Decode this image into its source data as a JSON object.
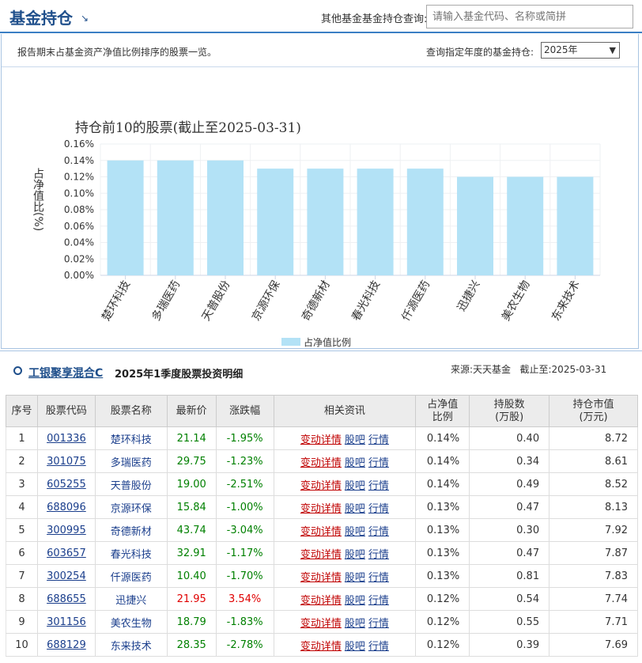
{
  "header": {
    "title": "基金持仓",
    "query_label": "其他基金基金持仓查询:",
    "query_placeholder": "请输入基金代码、名称或简拼"
  },
  "desc": {
    "text": "报告期末占基金资产净值比例排序的股票一览。",
    "year_label": "查询指定年度的基金持仓:",
    "year_value": "2025年"
  },
  "chart_data": {
    "type": "bar",
    "title": "持仓前10的股票(截止至2025-03-31)",
    "ylabel": "占净值比(%)",
    "categories": [
      "楚环科技",
      "多瑞医药",
      "天普股份",
      "京源环保",
      "奇德新材",
      "春光科技",
      "仟源医药",
      "迅捷兴",
      "美农生物",
      "东来技术"
    ],
    "series": [
      {
        "name": "占净值比例",
        "values": [
          0.14,
          0.14,
          0.14,
          0.13,
          0.13,
          0.13,
          0.13,
          0.12,
          0.12,
          0.12
        ]
      }
    ],
    "yticks": [
      "0.16%",
      "0.14%",
      "0.12%",
      "0.10%",
      "0.08%",
      "0.06%",
      "0.04%",
      "0.02%",
      "0.00%"
    ],
    "ylim": [
      0,
      0.16
    ],
    "legend_position": "bottom",
    "bar_color": "#b3e2f6"
  },
  "fund": {
    "name": "工银聚享混合C",
    "period_title": "2025年1季度股票投资明细",
    "source": "来源:天天基金",
    "as_of": "截止至:2025-03-31"
  },
  "table": {
    "headers": [
      "序号",
      "股票代码",
      "股票名称",
      "最新价",
      "涨跌幅",
      "相关资讯",
      "占净值\n比例",
      "持股数\n(万股)",
      "持仓市值\n(万元)"
    ],
    "link_labels": [
      "变动详情",
      "股吧",
      "行情"
    ],
    "rows": [
      {
        "no": "1",
        "code": "001336",
        "name": "楚环科技",
        "price": "21.14",
        "change": "-1.95%",
        "ratio": "0.14%",
        "shares": "0.40",
        "value": "8.72",
        "dir": "down"
      },
      {
        "no": "2",
        "code": "301075",
        "name": "多瑞医药",
        "price": "29.75",
        "change": "-1.23%",
        "ratio": "0.14%",
        "shares": "0.34",
        "value": "8.61",
        "dir": "down"
      },
      {
        "no": "3",
        "code": "605255",
        "name": "天普股份",
        "price": "19.00",
        "change": "-2.51%",
        "ratio": "0.14%",
        "shares": "0.49",
        "value": "8.52",
        "dir": "down"
      },
      {
        "no": "4",
        "code": "688096",
        "name": "京源环保",
        "price": "15.84",
        "change": "-1.00%",
        "ratio": "0.13%",
        "shares": "0.47",
        "value": "8.13",
        "dir": "down"
      },
      {
        "no": "5",
        "code": "300995",
        "name": "奇德新材",
        "price": "43.74",
        "change": "-3.04%",
        "ratio": "0.13%",
        "shares": "0.30",
        "value": "7.92",
        "dir": "down"
      },
      {
        "no": "6",
        "code": "603657",
        "name": "春光科技",
        "price": "32.91",
        "change": "-1.17%",
        "ratio": "0.13%",
        "shares": "0.47",
        "value": "7.87",
        "dir": "down"
      },
      {
        "no": "7",
        "code": "300254",
        "name": "仟源医药",
        "price": "10.40",
        "change": "-1.70%",
        "ratio": "0.13%",
        "shares": "0.81",
        "value": "7.83",
        "dir": "down"
      },
      {
        "no": "8",
        "code": "688655",
        "name": "迅捷兴",
        "price": "21.95",
        "change": "3.54%",
        "ratio": "0.12%",
        "shares": "0.54",
        "value": "7.74",
        "dir": "up"
      },
      {
        "no": "9",
        "code": "301156",
        "name": "美农生物",
        "price": "18.79",
        "change": "-1.83%",
        "ratio": "0.12%",
        "shares": "0.55",
        "value": "7.71",
        "dir": "down"
      },
      {
        "no": "10",
        "code": "688129",
        "name": "东来技术",
        "price": "28.35",
        "change": "-2.78%",
        "ratio": "0.12%",
        "shares": "0.39",
        "value": "7.69",
        "dir": "down"
      }
    ]
  },
  "colors": {
    "up": "#e00000",
    "down": "#008000",
    "accent": "#1f4f8b"
  }
}
